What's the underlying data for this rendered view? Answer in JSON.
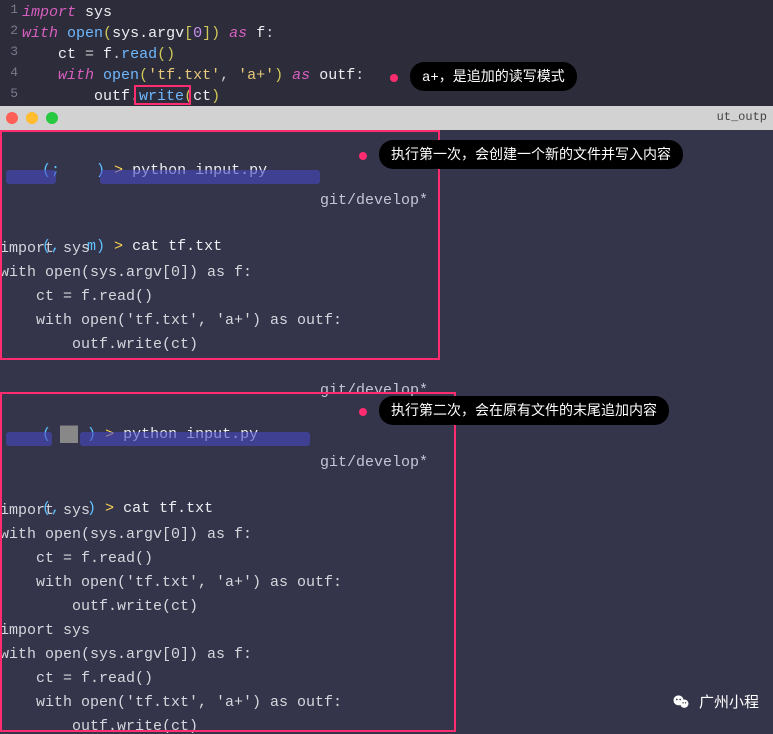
{
  "editor": {
    "lines": [
      {
        "num": "1",
        "html": "<span class='kw'>import</span> <span class='ident'>sys</span>"
      },
      {
        "num": "2",
        "html": "<span class='kw'>with</span> <span class='fn'>open</span><span class='par'>(</span><span class='ident'>sys.argv</span><span class='par'>[</span><span class='num'>0</span><span class='par'>]</span><span class='par'>)</span> <span class='kw'>as</span> <span class='ident'>f</span>:"
      },
      {
        "num": "3",
        "html": "    <span class='ident'>ct</span> = <span class='ident'>f</span>.<span class='fn'>read</span><span class='par'>()</span>"
      },
      {
        "num": "4",
        "html": "    <span class='kw'>with</span> <span class='fn'>open</span><span class='par'>(</span><span class='str'>'tf.txt'</span>, <span class='str'>'a+'</span><span class='par'>)</span> <span class='kw'>as</span> <span class='ident'>outf</span>:"
      },
      {
        "num": "5",
        "html": "        <span class='ident'>outf</span>.<span class='fn'>write</span><span class='par'>(</span><span class='ident'>ct</span><span class='par'>)</span>"
      }
    ]
  },
  "annotations": {
    "a1": "a+，是追加的读写模式",
    "a2": "执行第一次，会创建一个新的文件并写入内容",
    "a3": "执行第二次，会在原有文件的末尾追加内容"
  },
  "tabTitle": "ut_outp",
  "terminal": {
    "block1": {
      "prompt1_path": "(;    )",
      "prompt1_cmd": "python input.py",
      "branch": "git/develop*",
      "prompt2_path": "(,   m)",
      "prompt2_cmd": "cat tf.txt",
      "out": [
        "import sys",
        "with open(sys.argv[0]) as f:",
        "    ct = f.read()",
        "    with open('tf.txt', 'a+') as outf:",
        "        outf.write(ct)"
      ]
    },
    "block2": {
      "branch1": "git/develop*",
      "prompt1_path": "(    )",
      "prompt1_cmd": "python input.py",
      "branch2": "git/develop*",
      "prompt2_path": "(,   )",
      "prompt2_cmd": "cat tf.txt",
      "out": [
        "import sys",
        "with open(sys.argv[0]) as f:",
        "    ct = f.read()",
        "    with open('tf.txt', 'a+') as outf:",
        "        outf.write(ct)",
        "import sys",
        "with open(sys.argv[0]) as f:",
        "    ct = f.read()",
        "    with open('tf.txt', 'a+') as outf:",
        "        outf.write(ct)"
      ]
    }
  },
  "watermark": "广州小程"
}
